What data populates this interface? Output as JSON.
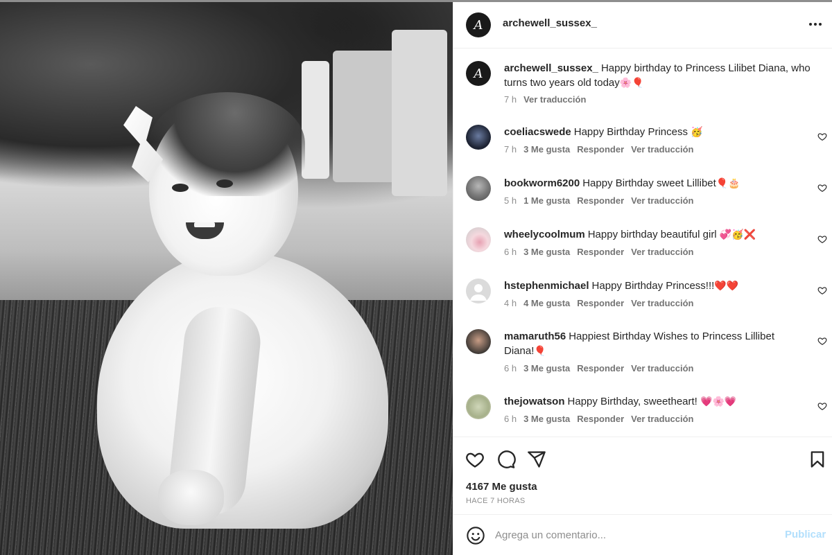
{
  "post": {
    "username": "archewell_sussex_",
    "avatar_letter": "A",
    "more_icon": "more-options-icon"
  },
  "caption": {
    "username": "archewell_sussex_",
    "text": "Happy birthday to Princess Lilibet Diana, who turns two years old today",
    "emoji": "🌸🎈",
    "time": "7 h",
    "translate": "Ver traducción"
  },
  "comments": [
    {
      "username": "coeliacswede",
      "text": "Happy Birthday Princess",
      "emoji": "🥳",
      "time": "7 h",
      "likes": "3 Me gusta",
      "reply": "Responder",
      "translate": "Ver traducción"
    },
    {
      "username": "bookworm6200",
      "text": "Happy Birthday sweet Lillibet",
      "emoji": "🎈🎂",
      "time": "5 h",
      "likes": "1 Me gusta",
      "reply": "Responder",
      "translate": "Ver traducción"
    },
    {
      "username": "wheelycoolmum",
      "text": "Happy birthday beautiful girl",
      "emoji": "💞🥳❌",
      "time": "6 h",
      "likes": "3 Me gusta",
      "reply": "Responder",
      "translate": "Ver traducción"
    },
    {
      "username": "hstephenmichael",
      "text": "Happy Birthday Princess!!!",
      "emoji": "❤️❤️",
      "time": "4 h",
      "likes": "4 Me gusta",
      "reply": "Responder",
      "translate": "Ver traducción"
    },
    {
      "username": "mamaruth56",
      "text": "Happiest Birthday Wishes to Princess Lillibet Diana!",
      "emoji": "🎈",
      "time": "6 h",
      "likes": "3 Me gusta",
      "reply": "Responder",
      "translate": "Ver traducción"
    },
    {
      "username": "thejowatson",
      "text": "Happy Birthday, sweetheart!",
      "emoji": "💗🌸💗",
      "time": "6 h",
      "likes": "3 Me gusta",
      "reply": "Responder",
      "translate": "Ver traducción"
    }
  ],
  "footer": {
    "likes": "4167 Me gusta",
    "time": "HACE 7 HORAS"
  },
  "add_comment": {
    "placeholder": "Agrega un comentario...",
    "publish": "Publicar"
  },
  "colors": {
    "text": "#262626",
    "muted": "#8e8e8e",
    "publish_disabled": "#b2dffc",
    "divider": "#efefef"
  }
}
